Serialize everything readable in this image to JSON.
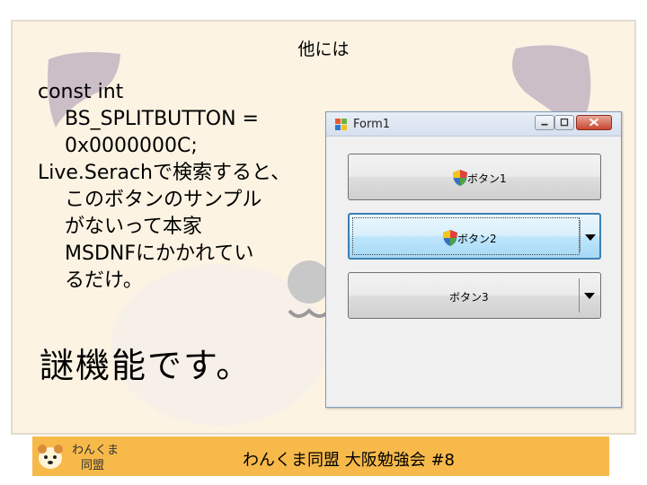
{
  "slide": {
    "title": "他には",
    "body_lines": [
      "const int",
      "BS_SPLITBUTTON =",
      "0x0000000C;",
      "Live.Serachで検索すると、",
      "このボタンのサンプル",
      "がないって本家",
      "MSDNFにかかれてい",
      "るだけ。"
    ],
    "big_text": "謎機能です。"
  },
  "form": {
    "title": "Form1",
    "buttons": [
      {
        "label": "ボタン1",
        "shield": true,
        "split": false
      },
      {
        "label": "ボタン2",
        "shield": true,
        "split": true
      },
      {
        "label": "ボタン3",
        "shield": false,
        "split": true
      }
    ]
  },
  "footer": {
    "logo_text": [
      "わんくま",
      "同盟"
    ],
    "text": "わんくま同盟 大阪勉強会 #8"
  },
  "colors": {
    "slide_bg": "#fcf3e3",
    "footer_bg": "#f7b94a",
    "deco_purple": "#c8b9c4",
    "deco_gray": "#bcbcbc"
  }
}
